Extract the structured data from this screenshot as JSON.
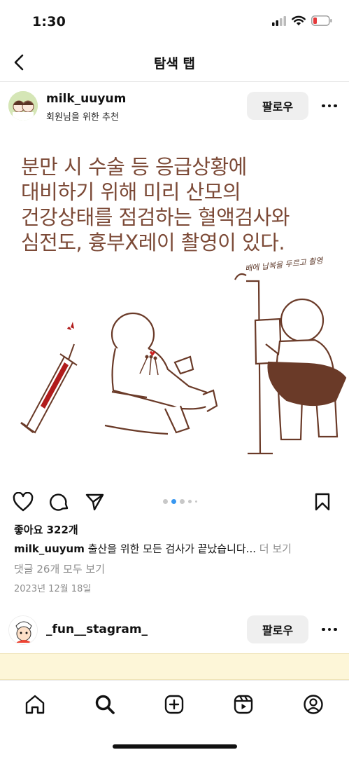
{
  "status": {
    "time": "1:30"
  },
  "nav": {
    "title": "탐색 탭"
  },
  "post": {
    "username": "milk_uuyum",
    "subtext": "회원님을 위한 추천",
    "follow_label": "팔로우",
    "image_text": [
      "분만 시 수술 등 응급상황에",
      "대비하기 위해 미리 산모의",
      "건강상태를 점검하는 혈액검사와",
      "심전도, 흉부X레이 촬영이 있다."
    ],
    "image_note": "배에 납복을 두르고 촬영",
    "carousel": {
      "count": 5,
      "active_index": 1
    },
    "likes": "좋아요 322개",
    "caption_user": "milk_uuyum",
    "caption_text": " 출산을 위한 모든 검사가 끝났습니다...",
    "caption_more": " 더 보기",
    "comments_link": "댓글 26개 모두 보기",
    "date": "2023년 12월 18일"
  },
  "post2": {
    "username": "_fun__stagram_",
    "follow_label": "팔로우"
  },
  "icons": {
    "back": "chevron-left-icon",
    "like": "heart-icon",
    "comment": "comment-icon",
    "share": "send-icon",
    "save": "bookmark-icon",
    "tabs": [
      "home-icon",
      "search-icon",
      "create-icon",
      "reels-icon",
      "profile-icon"
    ]
  },
  "colors": {
    "illustration_brown": "#7c4a37",
    "battery_low": "#e5393b",
    "carousel_active": "#3897f0",
    "follow_button_bg": "#efefef"
  }
}
